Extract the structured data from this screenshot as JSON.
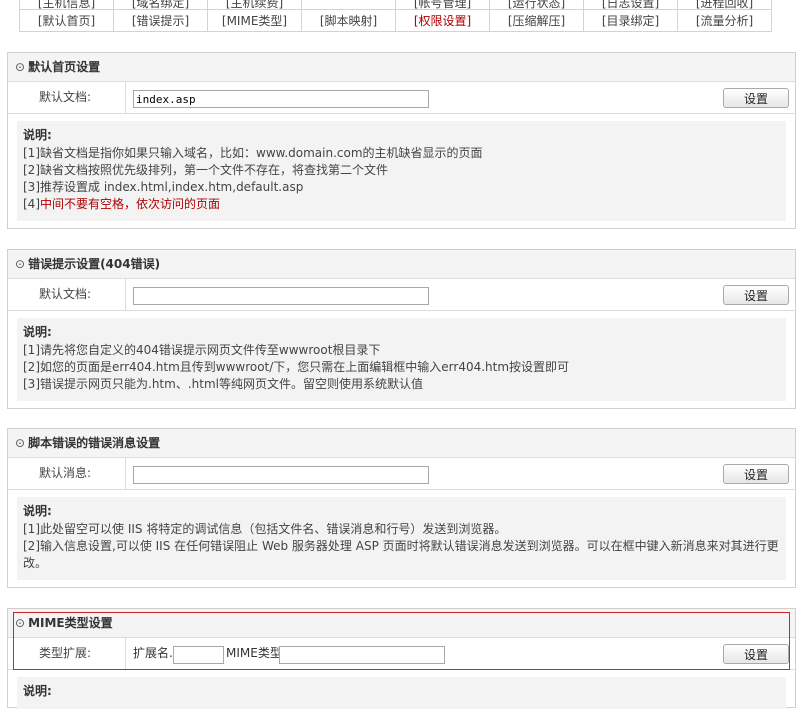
{
  "nav": {
    "row0": [
      "[主机信息]",
      "[域名绑定]",
      "[主机续费]",
      "",
      "[帐号管理]",
      "[运行状态]",
      "[日志设置]",
      "[进程回收]"
    ],
    "row1": [
      "[默认首页]",
      "[错误提示]",
      "[MIME类型]",
      "[脚本映射]",
      "[权限设置]",
      "[压缩解压]",
      "[目录绑定]",
      "[流量分析]"
    ],
    "active_index": 4
  },
  "default_page": {
    "title": "默认首页设置",
    "label": "默认文档:",
    "value": "index.asp",
    "button": "设置",
    "note_title": "说明:",
    "notes": [
      "[1]缺省文档是指你如果只输入域名，比如：www.domain.com的主机缺省显示的页面",
      "[2]缺省文档按照优先级排列，第一个文件不存在，将查找第二个文件",
      "[3]推荐设置成  index.html,index.htm,default.asp"
    ],
    "note4_prefix": "[4]",
    "note4_red": "中间不要有空格，依次访问的页面"
  },
  "error_page": {
    "title": "错误提示设置(404错误)",
    "label": "默认文档:",
    "value": "",
    "button": "设置",
    "note_title": "说明:",
    "notes": [
      "[1]请先将您自定义的404错误提示网页文件传至wwwroot根目录下",
      "[2]如您的页面是err404.htm且传到wwwroot/下，您只需在上面编辑框中输入err404.htm按设置即可",
      "[3]错误提示网页只能为.htm、.html等纯网页文件。留空则使用系统默认值"
    ]
  },
  "script_error": {
    "title": "脚本错误的错误消息设置",
    "label": "默认消息:",
    "value": "",
    "button": "设置",
    "note_title": "说明:",
    "notes": [
      "[1]此处留空可以使  IIS 将特定的调试信息（包括文件名、错误消息和行号）发送到浏览器。",
      "[2]输入信息设置,可以使  IIS 在任何错误阻止  Web 服务器处理  ASP 页面时将默认错误消息发送到浏览器。可以在框中键入新消息来对其进行更改。"
    ]
  },
  "mime": {
    "title": "MIME类型设置",
    "label": "类型扩展:",
    "ext_label": "扩展名.",
    "type_label": "MIME类型",
    "button": "设置",
    "note_title": "说明:"
  },
  "colors": {
    "accent_red": "#b00000",
    "highlight_border": "#c8282c"
  }
}
